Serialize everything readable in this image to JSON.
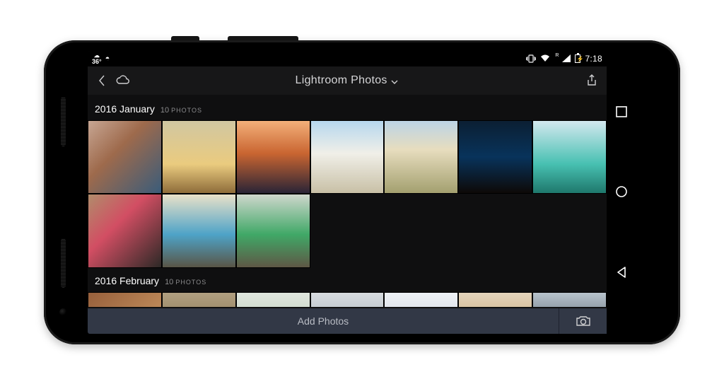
{
  "status": {
    "temp": "36°",
    "time": "7:18"
  },
  "toolbar": {
    "title": "Lightroom Photos"
  },
  "sections": [
    {
      "title": "2016 January",
      "count": "10",
      "count_unit": "PHOTOS"
    },
    {
      "title": "2016 February",
      "count": "10",
      "count_unit": "PHOTOS"
    }
  ],
  "bottom": {
    "add_label": "Add Photos"
  }
}
